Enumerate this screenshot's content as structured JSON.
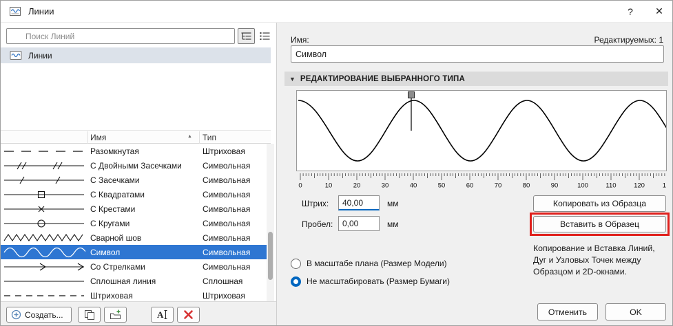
{
  "dialog": {
    "title": "Линии",
    "help_label": "?",
    "close_label": "✕"
  },
  "left": {
    "search_placeholder": "Поиск Линий",
    "tree_item_label": "Линии",
    "table": {
      "name_header": "Имя",
      "type_header": "Тип",
      "sort_icon": "▲",
      "rows": [
        {
          "name": "Разомкнутая",
          "type": "Штриховая",
          "preview": "dashed-long",
          "selected": false
        },
        {
          "name": "С Двойными Засечками",
          "type": "Символьная",
          "preview": "double-ticks",
          "selected": false
        },
        {
          "name": "С Засечками",
          "type": "Символьная",
          "preview": "ticks",
          "selected": false
        },
        {
          "name": "С Квадратами",
          "type": "Символьная",
          "preview": "squares",
          "selected": false
        },
        {
          "name": "С Крестами",
          "type": "Символьная",
          "preview": "crosses",
          "selected": false
        },
        {
          "name": "С Кругами",
          "type": "Символьная",
          "preview": "circles",
          "selected": false
        },
        {
          "name": "Сварной шов",
          "type": "Символьная",
          "preview": "weld",
          "selected": false
        },
        {
          "name": "Символ",
          "type": "Символьная",
          "preview": "wave",
          "selected": true
        },
        {
          "name": "Со Стрелками",
          "type": "Символьная",
          "preview": "arrows",
          "selected": false
        },
        {
          "name": "Сплошная линия",
          "type": "Сплошная",
          "preview": "solid",
          "selected": false
        },
        {
          "name": "Штриховая",
          "type": "Штриховая",
          "preview": "dashed-short",
          "selected": false
        }
      ]
    },
    "toolbar": {
      "create_label": "Создать...",
      "icon_buttons": [
        "duplicate",
        "new-folder",
        "rename",
        "delete"
      ]
    }
  },
  "right": {
    "name_label": "Имя:",
    "editable_count": "Редактируемых: 1",
    "name_value": "Символ",
    "section_title": "РЕДАКТИРОВАНИЕ ВЫБРАННОГО ТИПА",
    "ruler_labels": [
      "0",
      "10",
      "20",
      "30",
      "40",
      "50",
      "60",
      "70",
      "80",
      "90",
      "100",
      "110",
      "120",
      "1"
    ],
    "dash_label": "Штрих:",
    "dash_value": "40,00",
    "dash_unit": "мм",
    "gap_label": "Пробел:",
    "gap_value": "0,00",
    "gap_unit": "мм",
    "copy_button": "Копировать из Образца",
    "paste_button": "Вставить в Образец",
    "radios": [
      {
        "label": "В масштабе плана (Размер Модели)",
        "selected": false
      },
      {
        "label": "Не масштабировать (Размер Бумаги)",
        "selected": true
      }
    ],
    "hint": "Копирование и Вставка Линий, Дуг и Узловых Точек между Образцом и 2D-окнами.",
    "cancel_button": "Отменить",
    "ok_button": "OK"
  },
  "colors": {
    "selection_blue": "#2e76d2",
    "accent_blue": "#0067c0",
    "annotation_red": "#e0201c"
  }
}
